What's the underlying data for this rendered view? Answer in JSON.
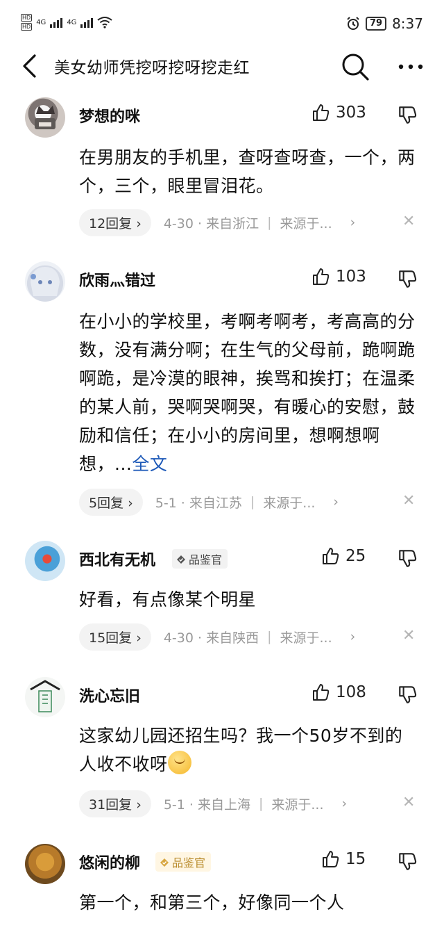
{
  "status_bar": {
    "network_1": "4G",
    "network_2": "4G",
    "battery": "79",
    "time": "8:37"
  },
  "header": {
    "title": "美女幼师凭挖呀挖呀挖走红"
  },
  "comments": [
    {
      "username": "梦想的咪",
      "likes": "303",
      "text": "在男朋友的手机里，查呀查呀查，一个，两个，三个，眼里冒泪花。",
      "replies": "12回复 ›",
      "date_location": "4-30 · 来自浙江",
      "source": "来源于...",
      "badge": ""
    },
    {
      "username": "欣雨灬错过",
      "likes": "103",
      "text": "在小小的学校里，考啊考啊考，考高高的分数，没有满分啊；在生气的父母前，跪啊跪啊跪，是冷漠的眼神，挨骂和挨打；在温柔的某人前，哭啊哭啊哭，有暖心的安慰，鼓励和信任；在小小的房间里，想啊想啊想，...",
      "full_text_link": "全文",
      "replies": "5回复 ›",
      "date_location": "5-1 · 来自江苏",
      "source": "来源于...",
      "badge": ""
    },
    {
      "username": "西北有无机",
      "badge": "品鉴官",
      "likes": "25",
      "text": "好看，有点像某个明星",
      "replies": "15回复 ›",
      "date_location": "4-30 · 来自陕西",
      "source": "来源于..."
    },
    {
      "username": "洗心忘旧",
      "likes": "108",
      "text": "这家幼儿园还招生吗？我一个50岁不到的人收不收呀",
      "emoji": "smiling-face-emoji",
      "replies": "31回复 ›",
      "date_location": "5-1 · 来自上海",
      "source": "来源于...",
      "badge": ""
    },
    {
      "username": "悠闲的柳",
      "badge": "品鉴官",
      "likes": "15",
      "text": "第一个，和第三个，好像同一个人"
    }
  ],
  "colors": {
    "link": "#1d59b8",
    "badge_gold": "#b88a2a",
    "meta_gray": "#999999"
  }
}
